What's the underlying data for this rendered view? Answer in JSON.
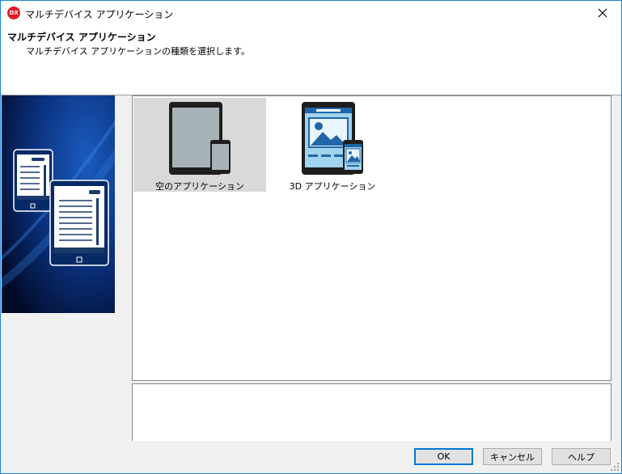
{
  "window": {
    "title": "マルチデバイス アプリケーション",
    "app_icon_text": "DX",
    "close_icon": "close-icon",
    "accent_color": "#1883d7"
  },
  "header": {
    "title": "マルチデバイス アプリケーション",
    "subtitle": "マルチデバイス アプリケーションの種類を選択します。"
  },
  "banner": {
    "icon": "multi-device-banner-illustration",
    "background_color": "#0a2c6e"
  },
  "templates": [
    {
      "label": "空のアプリケーション",
      "icon": "blank-app-tablet-phone-icon",
      "selected": true
    },
    {
      "label": "3D アプリケーション",
      "icon": "3d-app-tablet-phone-icon",
      "selected": false
    }
  ],
  "description": {
    "text": ""
  },
  "buttons": {
    "ok": "OK",
    "cancel": "キャンセル",
    "help": "ヘルプ"
  }
}
